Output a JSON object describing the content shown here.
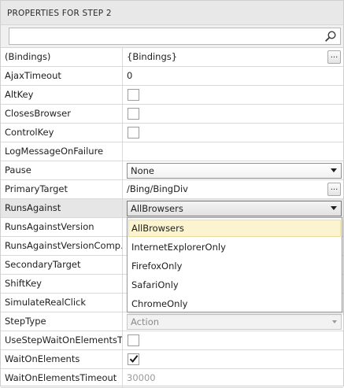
{
  "header": {
    "title": "PROPERTIES FOR STEP 2"
  },
  "search": {
    "placeholder": "",
    "value": ""
  },
  "properties": {
    "bindings": {
      "name": "(Bindings)",
      "value": "{Bindings}"
    },
    "ajax_timeout": {
      "name": "AjaxTimeout",
      "value": "0"
    },
    "alt_key": {
      "name": "AltKey",
      "checked": false
    },
    "closes_browser": {
      "name": "ClosesBrowser",
      "checked": false
    },
    "control_key": {
      "name": "ControlKey",
      "checked": false
    },
    "log_message_on_failure": {
      "name": "LogMessageOnFailure",
      "value": ""
    },
    "pause": {
      "name": "Pause",
      "value": "None"
    },
    "primary_target": {
      "name": "PrimaryTarget",
      "value": "/Bing/BingDiv"
    },
    "runs_against": {
      "name": "RunsAgainst",
      "value": "AllBrowsers"
    },
    "runs_against_version": {
      "name": "RunsAgainstVersion",
      "value": ""
    },
    "runs_against_version_comp": {
      "name": "RunsAgainstVersionComp...",
      "value": ""
    },
    "secondary_target": {
      "name": "SecondaryTarget",
      "value": ""
    },
    "shift_key": {
      "name": "ShiftKey",
      "value": ""
    },
    "simulate_real_click": {
      "name": "SimulateRealClick",
      "value": ""
    },
    "step_type": {
      "name": "StepType",
      "value": "Action"
    },
    "use_step_wait": {
      "name": "UseStepWaitOnElementsT...",
      "checked": false
    },
    "wait_on_elements": {
      "name": "WaitOnElements",
      "checked": true
    },
    "wait_on_elements_timeout": {
      "name": "WaitOnElementsTimeout",
      "value": "30000"
    }
  },
  "runs_against_dropdown": {
    "options": [
      "AllBrowsers",
      "InternetExplorerOnly",
      "FirefoxOnly",
      "SafariOnly",
      "ChromeOnly"
    ],
    "highlighted": "AllBrowsers"
  },
  "buttons": {
    "ellipsis_label": "..."
  },
  "colors": {
    "header_bg": "#e8e8e8",
    "selected_row_bg": "#e6e6e6",
    "highlight_option_bg": "#fcf3cf",
    "grid_line": "#d9d9d9"
  }
}
